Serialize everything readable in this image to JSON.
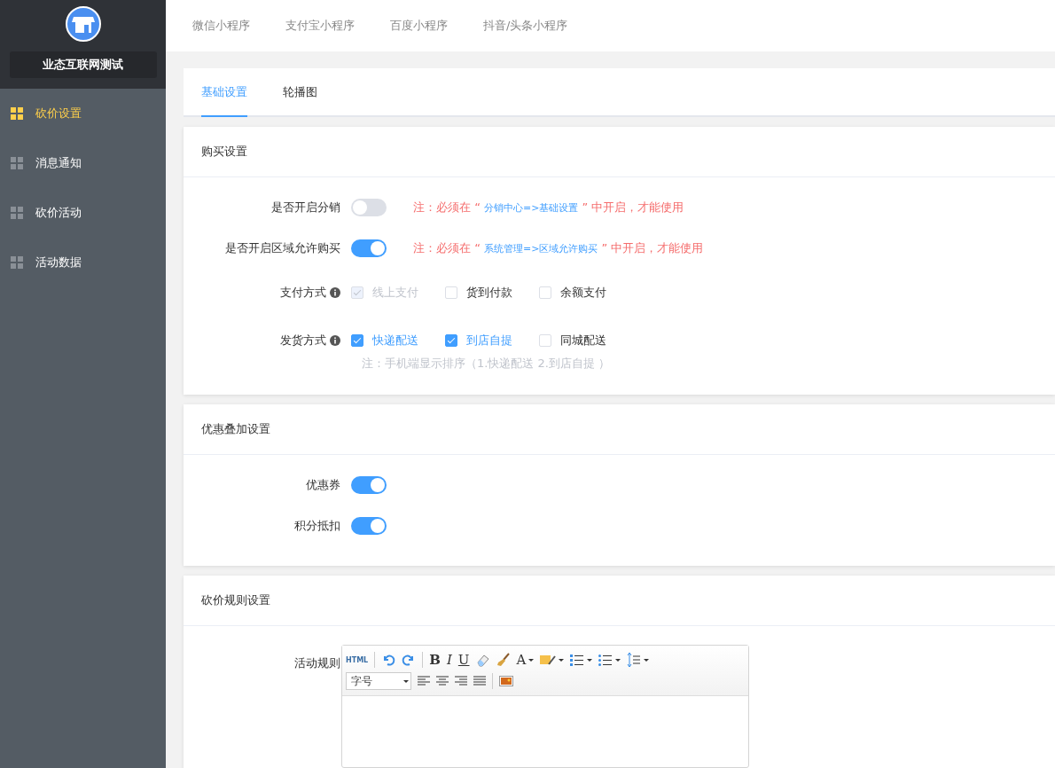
{
  "top_tabs": [
    {
      "label": "微信小程序"
    },
    {
      "label": "支付宝小程序"
    },
    {
      "label": "百度小程序"
    },
    {
      "label": "抖音/头条小程序"
    }
  ],
  "sidebar": {
    "shop_name": "业态互联网测试",
    "items": [
      {
        "label": "砍价设置",
        "selected": true
      },
      {
        "label": "消息通知",
        "selected": false
      },
      {
        "label": "砍价活动",
        "selected": false
      },
      {
        "label": "活动数据",
        "selected": false
      }
    ]
  },
  "page_tabs": [
    {
      "label": "基础设置",
      "selected": true
    },
    {
      "label": "轮播图",
      "selected": false
    }
  ],
  "sections": [
    {
      "title": "购买设置",
      "fields": [
        {
          "kind": "switch",
          "label": "是否开启分销",
          "on": false,
          "note": {
            "before": "注：必须在 “",
            "link": "分销中心=>基础设置",
            "after": "” 中开启，才能使用"
          }
        },
        {
          "kind": "switch",
          "label": "是否开启区域允许购买",
          "on": true,
          "note": {
            "before": "注：必须在 “",
            "link": "系统管理=>区域允许购买",
            "after": "” 中开启，才能使用"
          }
        },
        {
          "kind": "checks",
          "label": "支付方式",
          "options": [
            {
              "label": "线上支付",
              "checked": true,
              "disabled": true
            },
            {
              "label": "货到付款",
              "checked": false,
              "disabled": false
            },
            {
              "label": "余额支付",
              "checked": false,
              "disabled": false
            }
          ]
        },
        {
          "kind": "checks",
          "label": "发货方式",
          "options": [
            {
              "label": "快递配送",
              "checked": true,
              "disabled": false
            },
            {
              "label": "到店自提",
              "checked": true,
              "disabled": false
            },
            {
              "label": "同城配送",
              "checked": false,
              "disabled": false
            }
          ],
          "hint": "注：手机端显示排序（1.快递配送 2.到店自提 ）"
        }
      ]
    },
    {
      "title": "优惠叠加设置",
      "fields": [
        {
          "kind": "switch",
          "label": "优惠券",
          "on": true
        },
        {
          "kind": "switch",
          "label": "积分抵扣",
          "on": true
        }
      ]
    },
    {
      "title": "砍价规则设置",
      "fields": [
        {
          "kind": "editor",
          "label": "活动规则",
          "html_button": "HTML",
          "font_size": "字号",
          "bold": "B",
          "italic": "I",
          "underline": "U",
          "font_color": "A"
        }
      ]
    }
  ]
}
